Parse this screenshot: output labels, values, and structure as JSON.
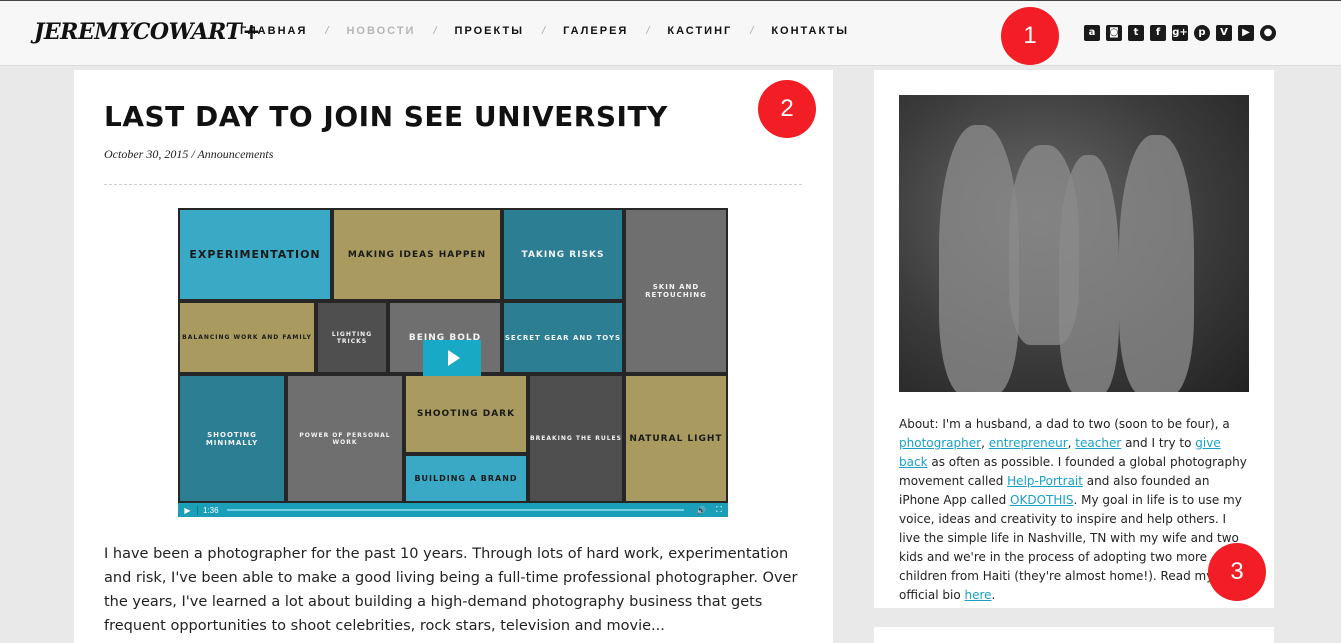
{
  "header": {
    "logo": "JEREMYCOWART",
    "logo_plus": "+",
    "nav": [
      {
        "label": "ГЛАВНАЯ",
        "active": false
      },
      {
        "label": "НОВОСТИ",
        "active": true
      },
      {
        "label": "ПРОЕКТЫ",
        "active": false
      },
      {
        "label": "ГАЛЕРЕЯ",
        "active": false
      },
      {
        "label": "КАСТИНГ",
        "active": false
      },
      {
        "label": "КОНТАКТЫ",
        "active": false
      }
    ],
    "nav_separator": "/",
    "social": [
      {
        "icon": "amazon-icon",
        "glyph": "a"
      },
      {
        "icon": "instagram-icon",
        "glyph": "◙"
      },
      {
        "icon": "twitter-icon",
        "glyph": "t"
      },
      {
        "icon": "facebook-icon",
        "glyph": "f"
      },
      {
        "icon": "google-plus-icon",
        "glyph": "g+"
      },
      {
        "icon": "pinterest-icon",
        "glyph": "p"
      },
      {
        "icon": "vimeo-icon",
        "glyph": "V"
      },
      {
        "icon": "youtube-icon",
        "glyph": "▶"
      },
      {
        "icon": "location-icon",
        "glyph": "●"
      }
    ]
  },
  "badges": [
    "1",
    "2",
    "3"
  ],
  "post": {
    "title": "LAST DAY TO JOIN SEE UNIVERSITY",
    "meta": "October 30, 2015 / Announcements",
    "video": {
      "tiles": [
        "EXPERIMENTATION",
        "MAKING IDEAS HAPPEN",
        "TAKING RISKS",
        "SKIN AND RETOUCHING",
        "BALANCING WORK AND FAMILY",
        "LIGHTING TRICKS",
        "BEING BOLD",
        "SECRET GEAR AND TOYS",
        "SHOOTING MINIMALLY",
        "POWER OF PERSONAL WORK",
        "SHOOTING DARK",
        "BREAKING THE RULES",
        "NATURAL LIGHT",
        "BUILDING A BRAND"
      ],
      "time": "1:36",
      "play_icon": "▶",
      "volume_icon": "🔊",
      "fullscreen_icon": "⛶"
    },
    "body": "I have been a photographer for the past 10 years. Through lots of hard work, experimentation and risk, I've been able to make a good living being a full-time professional photographer. Over the years, I've learned a lot about building a high-demand photography business that gets frequent opportunities to shoot celebrities, rock stars, television and movie..."
  },
  "sidebar": {
    "about": {
      "t1": "About: I'm a husband, a dad to two (soon to be four), a ",
      "l1": "photographer",
      "t2": ", ",
      "l2": "entrepreneur",
      "t3": ", ",
      "l3": "teacher",
      "t4": " and I try to ",
      "l4": "give back",
      "t5": " as often as possible. I founded a global photography movement called ",
      "l5": "Help-Portrait",
      "t6": " and also founded an iPhone App called ",
      "l6": "OKDOTHIS",
      "t7": ". My goal in life is to use my voice, ideas and creativity to inspire and help others. I live the simple life in Nashville, TN with my wife and two kids and we're in the process of adopting two more children from Haiti (they're almost home!). Read my official bio ",
      "l7": "here",
      "t8": "."
    }
  }
}
